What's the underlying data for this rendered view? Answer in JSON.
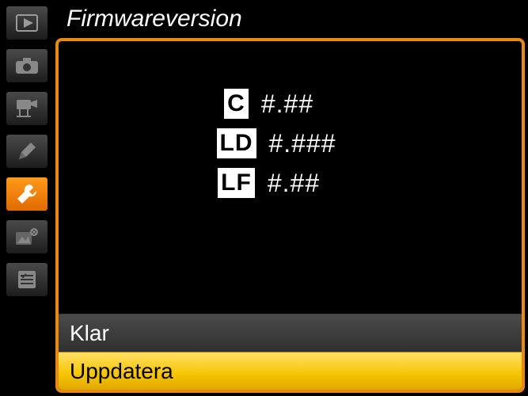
{
  "title": "Firmwareversion",
  "sidebar": {
    "items": [
      {
        "name": "playback-icon"
      },
      {
        "name": "camera-icon"
      },
      {
        "name": "movie-icon"
      },
      {
        "name": "pencil-icon"
      },
      {
        "name": "wrench-icon",
        "selected": true
      },
      {
        "name": "retouch-icon"
      },
      {
        "name": "mymenu-icon"
      }
    ]
  },
  "firmware": {
    "rows": [
      {
        "badge": "C",
        "value": "#.##"
      },
      {
        "badge": "LD",
        "value": "#.###"
      },
      {
        "badge": "LF",
        "value": "#.##"
      }
    ]
  },
  "options": {
    "ready_label": "Klar",
    "update_label": "Uppdatera"
  }
}
